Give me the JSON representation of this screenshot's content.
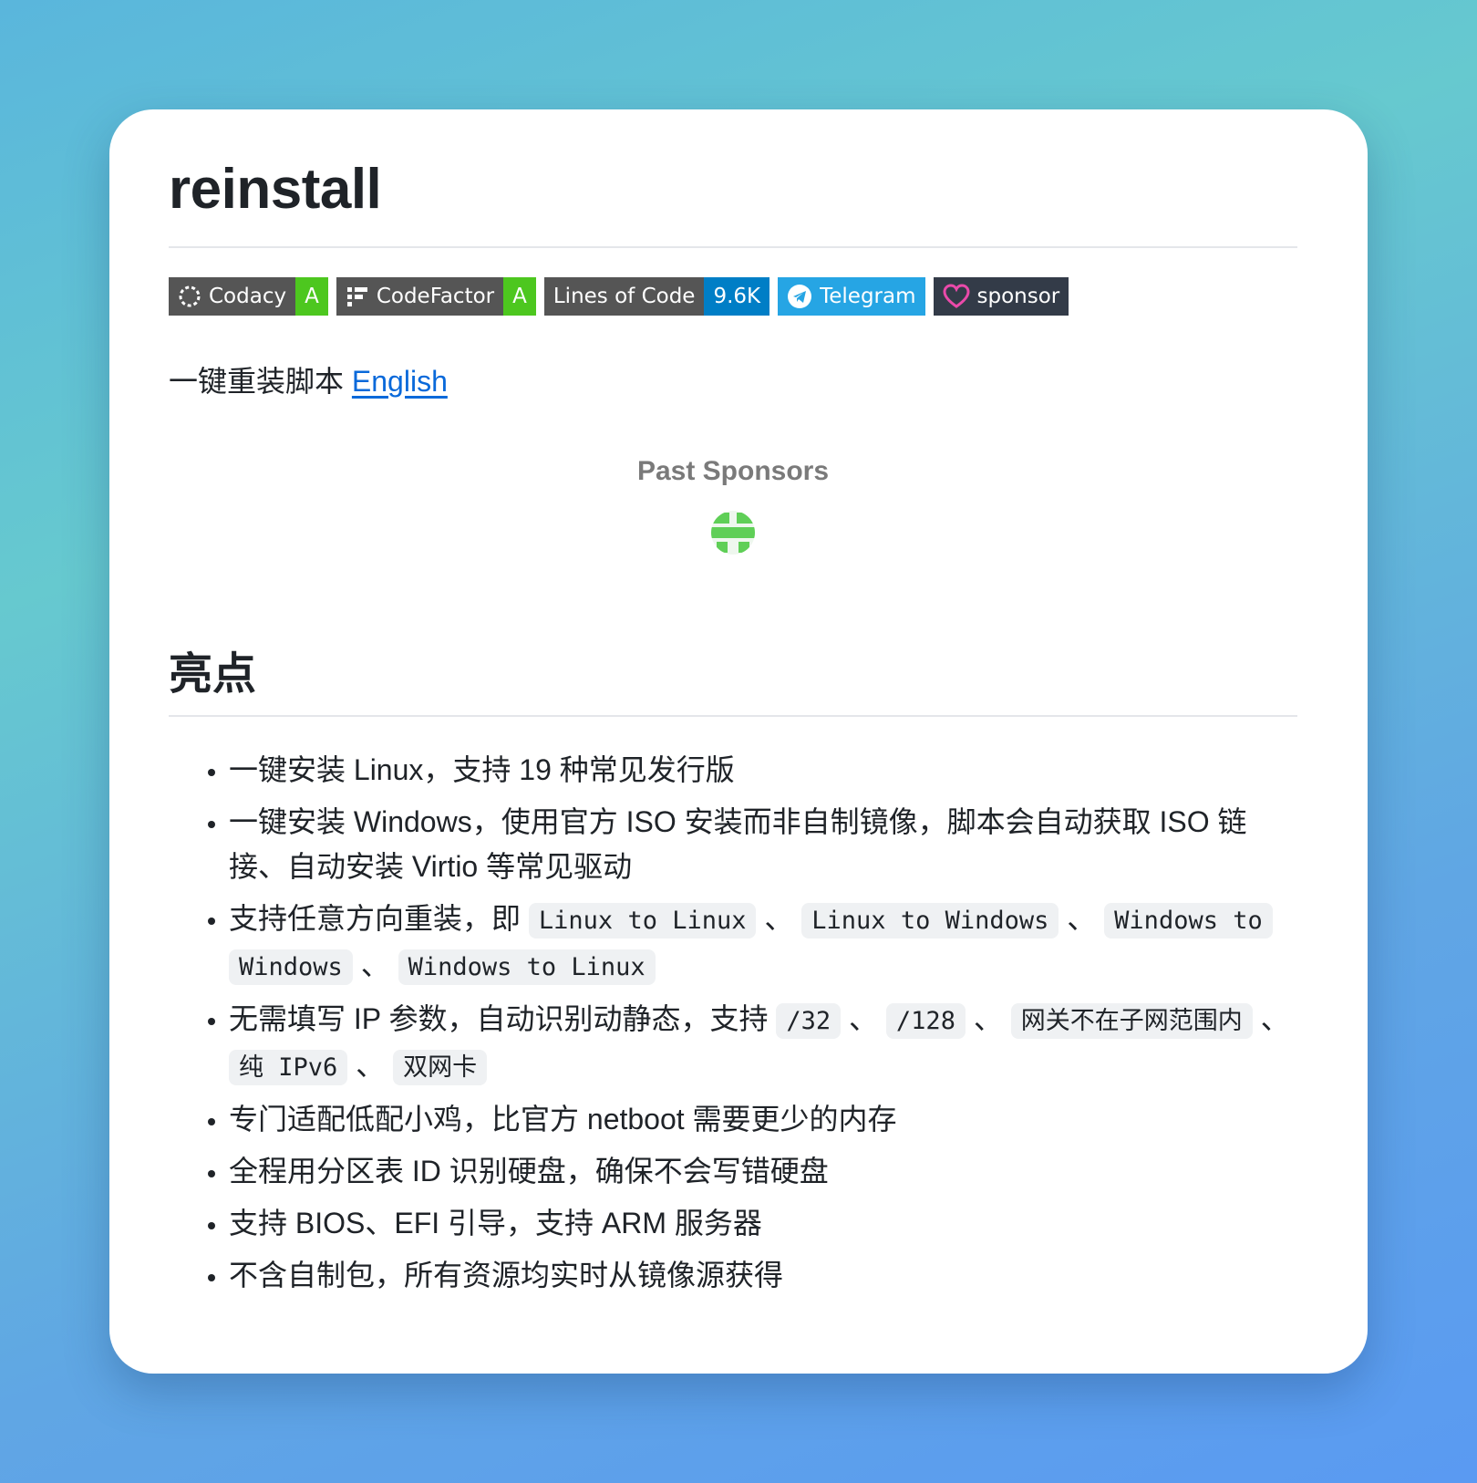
{
  "title": "reinstall",
  "badges": [
    {
      "label": "Codacy",
      "value": "A",
      "icon": "codacy-icon"
    },
    {
      "label": "CodeFactor",
      "value": "A",
      "icon": "codefactor-icon"
    },
    {
      "label": "Lines of Code",
      "value": "9.6K"
    },
    {
      "label": "Telegram",
      "icon": "telegram-icon"
    },
    {
      "label": "sponsor",
      "icon": "heart-icon"
    }
  ],
  "intro": {
    "text": "一键重装脚本 ",
    "link": "English"
  },
  "sponsors": {
    "title": "Past Sponsors"
  },
  "section": {
    "heading": "亮点"
  },
  "items": {
    "i0": "一键安装 Linux，支持 19 种常见发行版",
    "i1": "一键安装 Windows，使用官方 ISO 安装而非自制镜像，脚本会自动获取 ISO 链接、自动安装 Virtio 等常见驱动",
    "i2": {
      "t0": "支持任意方向重装，即 ",
      "c0": "Linux to Linux",
      "s0": " 、 ",
      "c1": "Linux to Windows",
      "s1": " 、 ",
      "c2": "Windows to Windows",
      "s2": " 、 ",
      "c3": "Windows to Linux"
    },
    "i3": {
      "t0": "无需填写 IP 参数，自动识别动静态，支持 ",
      "c0": "/32",
      "s0": " 、 ",
      "c1": "/128",
      "s1": " 、 ",
      "c2": "网关不在子网范围内",
      "s2": " 、 ",
      "c3": "纯 IPv6",
      "s3": " 、 ",
      "c4": "双网卡"
    },
    "i4": "专门适配低配小鸡，比官方 netboot 需要更少的内存",
    "i5": "全程用分区表 ID 识别硬盘，确保不会写错硬盘",
    "i6": "支持 BIOS、EFI 引导，支持 ARM 服务器",
    "i7": "不含自制包，所有资源均实时从镜像源获得"
  }
}
